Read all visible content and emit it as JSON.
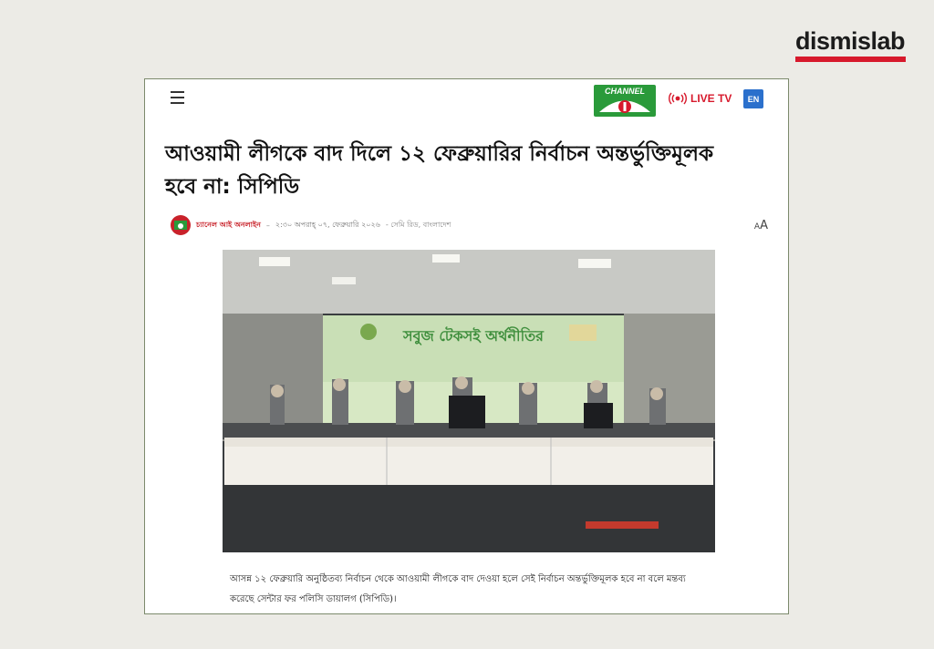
{
  "brand": {
    "name": "dismislab"
  },
  "header": {
    "channel_label": "CHANNEL",
    "live_label": "LIVE TV",
    "lang_label": "EN"
  },
  "article": {
    "title": "আওয়ামী লীগকে বাদ দিলে ১২ ফেব্রুয়ারির নির্বাচন অন্তর্ভুক্তিমূলক হবে না: সিপিডি",
    "author": "চ্যানেল আই অনলাইন",
    "dash": "–",
    "time": "২:৩০ অপরাহ্ ০৭, ফেব্রুয়ারি ২০২৬",
    "location": "- সেমি রিড, বাংলাদেশ",
    "font_toggle": "AA",
    "banner_title": "সবুজ টেকসই অর্থনীতির",
    "caption": "আসন্ন ১২ ফেব্রুয়ারি অনুষ্ঠিতব্য নির্বাচন থেকে আওয়ামী লীগকে বাদ দেওয়া হলে সেই নির্বাচন অন্তর্ভুক্তিমূলক হবে না বলে মন্তব্য করেছে সেন্টার ফর পলিসি ডায়ালগ (সিপিডি)।"
  },
  "colors": {
    "accent": "#d7192c",
    "channel_green": "#2a9a3a",
    "en_blue": "#2b70cc",
    "card_border": "#7c8a6c"
  }
}
